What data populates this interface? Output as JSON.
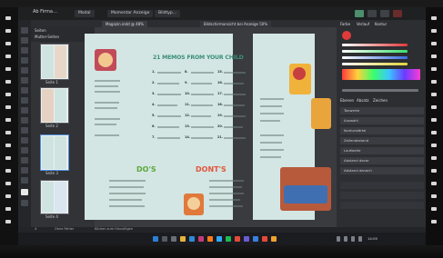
{
  "titlebar": {
    "app_title": "Ab Firma…",
    "menu_tab_1": "Modal",
    "menu_tab_2": "Momentar Anzeige",
    "menu_tab_3": "Bildtyp…"
  },
  "document": {
    "tab_1": "Magazin.indd @ 48%",
    "tab_2": "Bildschirmansicht bei Anzeige 50%"
  },
  "pages_panel": {
    "title": "Seiten",
    "master_label": "Mutter-Seiten",
    "thumb_labels": [
      "Seite 1",
      "Seite 2",
      "Seite 3",
      "Seite 4"
    ]
  },
  "spread": {
    "headline": "21 MEMOS FROM YOUR CHILD",
    "dos_label": "DO'S",
    "donts_label": "DONT'S",
    "item_numbers": [
      "1.",
      "2.",
      "3.",
      "4.",
      "5.",
      "6.",
      "7.",
      "8.",
      "9.",
      "10.",
      "11.",
      "12.",
      "13.",
      "14.",
      "15.",
      "16.",
      "17.",
      "18.",
      "19.",
      "20.",
      "21."
    ]
  },
  "right_panel": {
    "tabs": [
      "Farbe",
      "Verlauf",
      "Kontur"
    ],
    "section_tabs": [
      "Ebenen",
      "Absatz",
      "Zeichen"
    ],
    "rows": [
      "Tonwerte",
      "Auswahl",
      "Konturstärke",
      "Zeilenabstand",
      "Laufweite",
      "Abstand davor",
      "Abstand danach"
    ]
  },
  "status": {
    "page_indicator": "4",
    "message": "Ohne Fehler",
    "hint": "Klicken zum Hinzufügen"
  },
  "taskbar": {
    "clock": "14:05"
  },
  "colors": {
    "accent_teal": "#3b8e7a",
    "dos_green": "#5aa83a",
    "donts_red": "#e2543a"
  }
}
